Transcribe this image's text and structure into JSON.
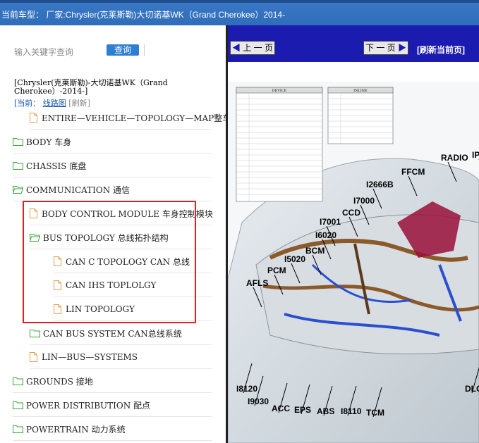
{
  "header": {
    "title": "当前车型： 厂家:Chrysler(克莱斯勒)大切诺基WK（Grand Cherokee）2014-"
  },
  "search": {
    "label": "输入关键字查询",
    "button": "查询"
  },
  "vehicle": {
    "title": "[Chrysler(克莱斯勒)-大切诺基WK（Grand Cherokee）-2014-]",
    "current_label": "[当前：",
    "crumb_link": "线路图",
    "refresh": "[刷新]"
  },
  "tree": [
    {
      "label": "ENTIRE—VEHICLE—TOPOLOGY—MAP整车",
      "type": "doc",
      "indent": 1
    },
    {
      "label": "BODY 车身",
      "type": "folder",
      "indent": 0
    },
    {
      "label": "CHASSIS 底盘",
      "type": "folder",
      "indent": 0
    },
    {
      "label": "COMMUNICATION 通信",
      "type": "folder-open",
      "indent": 0
    },
    {
      "label": "BODY CONTROL MODULE 车身控制模块",
      "type": "doc",
      "indent": 1
    },
    {
      "label": "BUS TOPOLOGY 总线拓扑结构",
      "type": "folder-open",
      "indent": 1
    },
    {
      "label": "CAN C TOPOLOGY CAN 总线",
      "type": "doc",
      "indent": 2
    },
    {
      "label": "CAN IHS TOPLOLGY",
      "type": "doc",
      "indent": 2
    },
    {
      "label": "LIN TOPOLOGY",
      "type": "doc",
      "indent": 2
    },
    {
      "label": "CAN BUS SYSTEM CAN总线系统",
      "type": "folder",
      "indent": 1
    },
    {
      "label": "LIN—BUS—SYSTEMS",
      "type": "doc",
      "indent": 1
    },
    {
      "label": "GROUNDS 接地",
      "type": "folder",
      "indent": 0
    },
    {
      "label": "POWER DISTRIBUTION 配点",
      "type": "folder",
      "indent": 0
    },
    {
      "label": "POWERTRAIN 动力系统",
      "type": "folder",
      "indent": 0
    }
  ],
  "viewer": {
    "prev": "上 一 页",
    "next": "下 一 页",
    "refresh": "[刷新当前页]"
  },
  "diagram": {
    "table_left_title": "DEVICE",
    "table_right_title": "INLINE",
    "labels": [
      "RADIO",
      "IP",
      "FFCM",
      "I2666B",
      "I7000",
      "CCD",
      "I7001",
      "I6020",
      "BCM",
      "I5020",
      "PCM",
      "AFLS",
      "I8120",
      "I9030",
      "ACC",
      "EPS",
      "ABS",
      "I8110",
      "TCM",
      "DLC"
    ]
  },
  "colors": {
    "header_bg": "#3a79c7",
    "nav_bg": "#1b1bb0",
    "highlight": "#e02020",
    "link": "#1a57b5"
  }
}
